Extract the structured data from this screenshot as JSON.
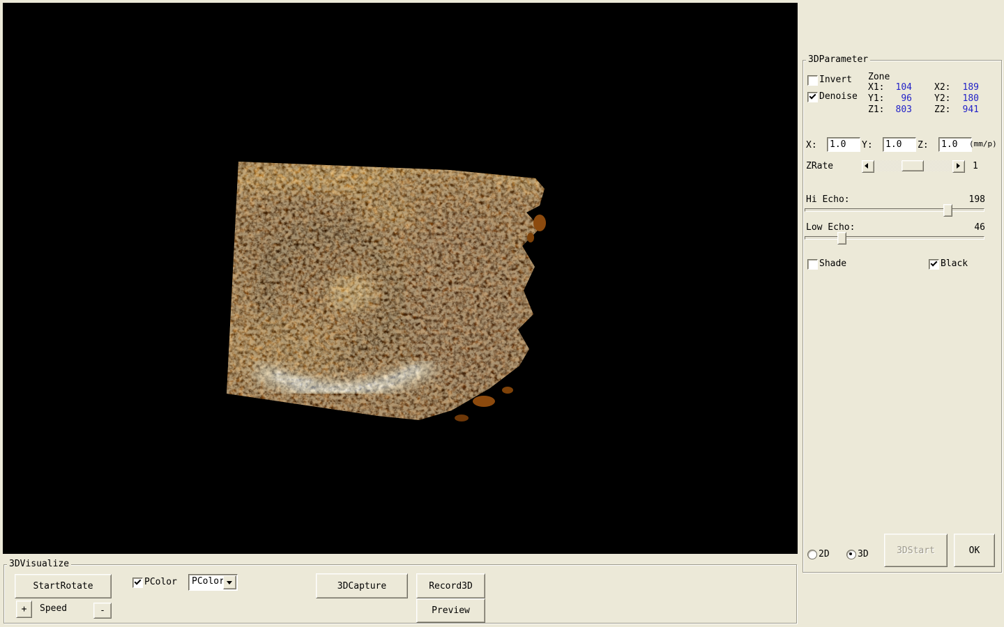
{
  "param": {
    "title": "3DParameter",
    "invert": {
      "label": "Invert",
      "checked": false
    },
    "denoise": {
      "label": "Denoise",
      "checked": true
    },
    "zone": {
      "title": "Zone",
      "x1_label": "X1:",
      "x1": "104",
      "x2_label": "X2:",
      "x2": "189",
      "y1_label": "Y1:",
      "y1": "96",
      "y2_label": "Y2:",
      "y2": "180",
      "z1_label": "Z1:",
      "z1": "803",
      "z2_label": "Z2:",
      "z2": "941"
    },
    "scale": {
      "x_label": "X:",
      "x": "1.0",
      "y_label": "Y:",
      "y": "1.0",
      "z_label": "Z:",
      "z": "1.0",
      "unit": "(mm/p)"
    },
    "zrate": {
      "label": "ZRate",
      "value": "1"
    },
    "hi_echo": {
      "label": "Hi Echo:",
      "value": "198"
    },
    "low_echo": {
      "label": "Low Echo:",
      "value": "46"
    },
    "shade": {
      "label": "Shade",
      "checked": false
    },
    "black": {
      "label": "Black",
      "checked": true
    },
    "mode_2d": {
      "label": "2D",
      "selected": false
    },
    "mode_3d": {
      "label": "3D",
      "selected": true
    },
    "start3d_button": "3DStart",
    "ok_button": "OK"
  },
  "visualize": {
    "title": "3DVisualize",
    "start_rotate_button": "StartRotate",
    "pcolor": {
      "label": "PColor",
      "checked": true,
      "selected_option": "PColor"
    },
    "capture_button": "3DCapture",
    "record_button": "Record3D",
    "preview_button": "Preview",
    "speed": {
      "label": "Speed",
      "plus": "+",
      "minus": "-"
    }
  },
  "colors": {
    "panel_bg": "#ece9d8",
    "viewport_bg": "#000000",
    "value_text": "#2222c8",
    "volume_base": "#95520e"
  }
}
